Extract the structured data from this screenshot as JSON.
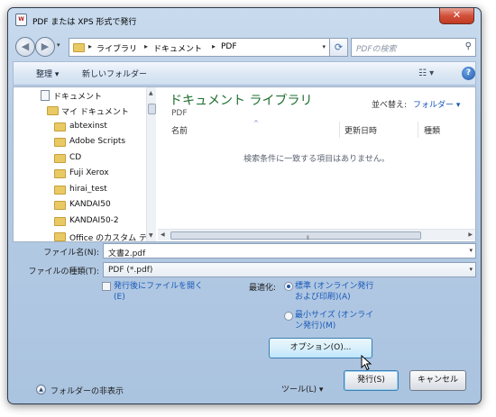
{
  "window": {
    "title": "PDF または XPS 形式で発行",
    "app_icon": "W",
    "close_label": "✕"
  },
  "nav": {
    "back_icon": "◀",
    "forward_icon": "▶",
    "dropdown_icon": "▾",
    "breadcrumbs": [
      "ライブラリ",
      "ドキュメント",
      "PDF"
    ],
    "refresh_icon": "⟳",
    "search_placeholder": "PDFの検索",
    "search_icon": "⚲"
  },
  "toolbar": {
    "organize": "整理 ▾",
    "new_folder": "新しいフォルダー",
    "views_icon": "☷ ▾",
    "help": "?"
  },
  "tree": [
    {
      "label": "ドキュメント",
      "type": "doc"
    },
    {
      "label": "マイ ドキュメント",
      "type": "folder"
    },
    {
      "label": "abtexinst",
      "type": "folder"
    },
    {
      "label": "Adobe Scripts",
      "type": "folder"
    },
    {
      "label": "CD",
      "type": "folder"
    },
    {
      "label": "Fuji Xerox",
      "type": "folder"
    },
    {
      "label": "hirai_test",
      "type": "folder"
    },
    {
      "label": "KANDAI50",
      "type": "folder"
    },
    {
      "label": "KANDAI50-2",
      "type": "folder"
    },
    {
      "label": "Office のカスタム テ",
      "type": "folder"
    }
  ],
  "library": {
    "title": "ドキュメント ライブラリ",
    "subtitle": "PDF",
    "arrange_label": "並べ替え:",
    "arrange_value": "フォルダー ▾",
    "columns": [
      "名前",
      "更新日時",
      "種類"
    ],
    "empty_message": "検索条件に一致する項目はありません。",
    "sort_icon": "^"
  },
  "scroll": {
    "left": "◀",
    "right": "▶",
    "up": "▲",
    "down": "▼",
    "grip": "⦀"
  },
  "form": {
    "filename_label": "ファイル名(N):",
    "filename_value": "文書2.pdf",
    "filetype_label": "ファイルの種類(T):",
    "filetype_value": "PDF (*.pdf)",
    "dropdown_icon": "▾"
  },
  "options": {
    "open_after_publish": "発行後にファイルを開く\n(E)",
    "open_line1": "発行後にファイルを開く",
    "open_line2": "(E)",
    "optimize_label": "最適化:",
    "standard_line1": "標準 (オンライン発行",
    "standard_line2": "および印刷)(A)",
    "minimum_line1": "最小サイズ (オンライ",
    "minimum_line2": "ン発行)(M)",
    "options_button": "オプション(O)..."
  },
  "footer": {
    "hide_folders": "フォルダーの非表示",
    "hide_icon": "▲",
    "tools": "ツール(L)   ▾",
    "publish": "発行(S)",
    "cancel": "キャンセル"
  }
}
